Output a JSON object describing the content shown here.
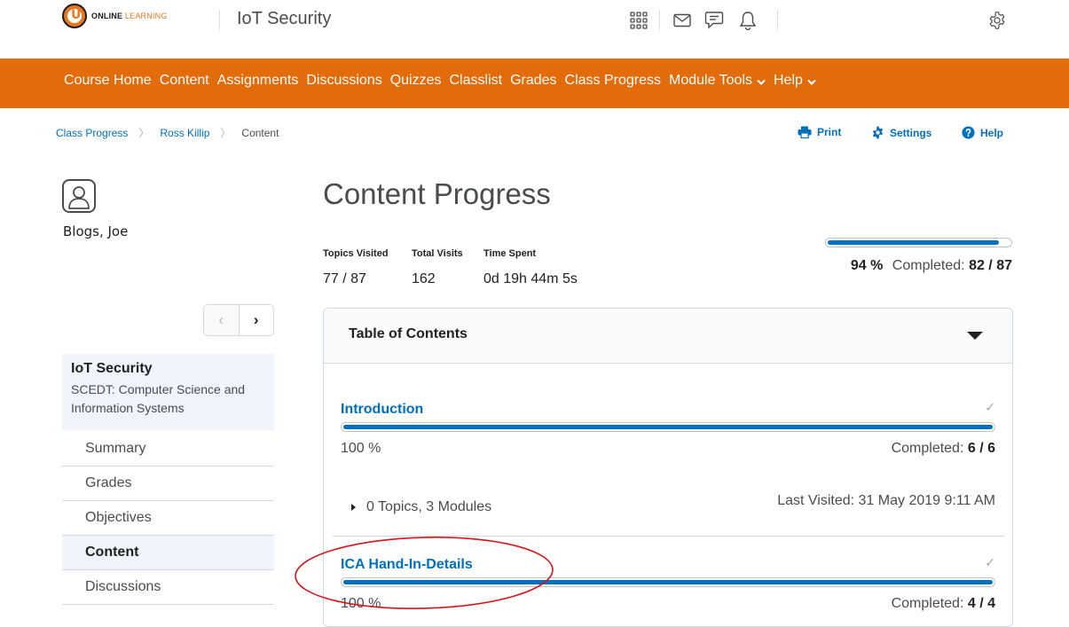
{
  "header": {
    "logo_main": "ONLINE",
    "logo_accent": "LEARNING",
    "logo_letter": "U",
    "site_title": "IoT Security",
    "icons": [
      "apps-grid-icon",
      "mail-icon",
      "chat-icon",
      "bell-icon",
      "gear-icon"
    ]
  },
  "nav": {
    "items": [
      "Course Home",
      "Content",
      "Assignments",
      "Discussions",
      "Quizzes",
      "Classlist",
      "Grades",
      "Class Progress",
      "Module Tools",
      "Help"
    ],
    "dropdown_indicator": "⌄"
  },
  "breadcrumb": {
    "items": [
      "Class Progress",
      "Ross Killip",
      "Content"
    ],
    "separator": "〉"
  },
  "tools": {
    "print": "Print",
    "settings": "Settings",
    "help": "Help"
  },
  "sidebar": {
    "user_name": "Blogs, Joe",
    "pager_prev": "‹",
    "pager_next": "›",
    "course_title": "IoT Security",
    "course_subtitle_line1": "SCEDT: Computer Science and",
    "course_subtitle_line2": "Information Systems",
    "menu": [
      "Summary",
      "Grades",
      "Objectives",
      "Content",
      "Discussions"
    ],
    "active_item": "Content"
  },
  "main": {
    "title": "Content Progress",
    "stats": [
      {
        "label": "Topics Visited",
        "value": "77 / 87"
      },
      {
        "label": "Total Visits",
        "value": "162"
      },
      {
        "label": "Time Spent",
        "value": "0d 19h 44m 5s"
      }
    ],
    "overall_progress_fraction": 0.94,
    "overall_percent_text": "94 %",
    "overall_completed_label": "Completed:",
    "overall_completed_value": "82 / 87",
    "toc_title": "Table of Contents",
    "modules": [
      {
        "name": "Introduction",
        "check": "✓",
        "progress_fraction": 1.0,
        "percent_text": "100 %",
        "completed_label": "Completed:",
        "completed_value": "6 / 6",
        "detail": "0 Topics, 3 Modules",
        "last_visited": "Last Visited: 31 May 2019 9:11 AM"
      },
      {
        "name": "ICA Hand-In-Details",
        "check": "✓",
        "progress_fraction": 1.0,
        "percent_text": "100 %",
        "completed_label": "Completed:",
        "completed_value": "4 / 4"
      }
    ]
  },
  "colors": {
    "nav_orange": "#e26b0a",
    "link_blue": "#006fbf",
    "annotation_red": "#d7141a"
  }
}
